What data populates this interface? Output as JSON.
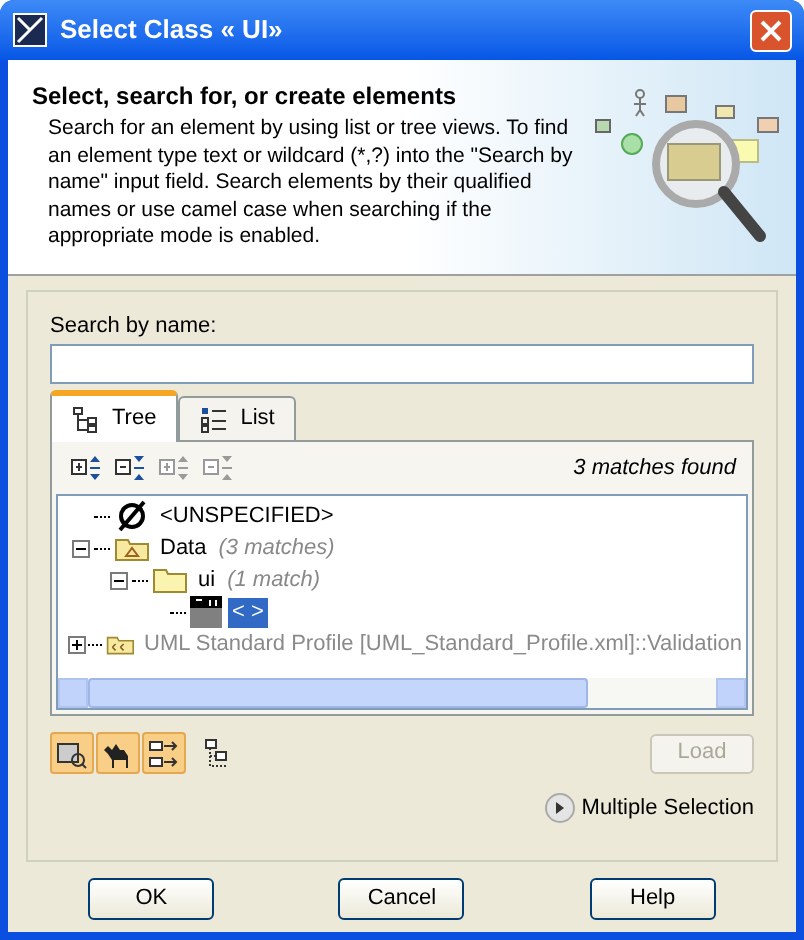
{
  "window": {
    "title": "Select Class « UI»"
  },
  "header": {
    "title": "Select, search for, or create elements",
    "description": "Search for an element by using list or tree views. To find an element type text or wildcard (*,?) into the \"Search by name\" input field. Search elements by their qualified names or use camel case when searching if the appropriate mode is enabled."
  },
  "search": {
    "label": "Search by name:"
  },
  "tabs": [
    {
      "label": "Tree",
      "kind": "tree",
      "selected": true
    },
    {
      "label": "List",
      "kind": "list",
      "selected": false
    }
  ],
  "toolbar": {
    "buttons": [
      {
        "kind": "expand",
        "disabled": false
      },
      {
        "kind": "collapse",
        "disabled": false
      },
      {
        "kind": "expand-matches",
        "disabled": true
      },
      {
        "kind": "collapse-matches",
        "disabled": true
      }
    ],
    "status": "3 matches found"
  },
  "tree": [
    {
      "kind": "none",
      "label": "<UNSPECIFIED>",
      "selected": false,
      "disabled": false
    },
    {
      "kind": "package",
      "label": "Data",
      "note": "(3 matches)",
      "expanded": true,
      "selected": false,
      "disabled": false,
      "children": [
        {
          "kind": "folder",
          "label": "ui",
          "note": "(1 match)",
          "expanded": true,
          "selected": false,
          "disabled": false,
          "children": [
            {
              "kind": "class",
              "label": "< >",
              "selected": true,
              "disabled": false
            }
          ]
        }
      ]
    },
    {
      "kind": "profile",
      "label": "UML Standard Profile [UML_Standard_Profile.xml]::Validation",
      "expanded": false,
      "selected": false,
      "disabled": true
    }
  ],
  "options": [
    {
      "kind": "qualified",
      "on": true
    },
    {
      "kind": "camel",
      "on": true
    },
    {
      "kind": "auxiliary",
      "on": true
    },
    {
      "kind": "hierarchy",
      "on": false
    }
  ],
  "load": {
    "label": "Load",
    "disabled": true
  },
  "multiple_selection": {
    "label": "Multiple Selection",
    "expanded": false
  },
  "buttons": [
    "OK",
    "Cancel",
    "Help"
  ]
}
